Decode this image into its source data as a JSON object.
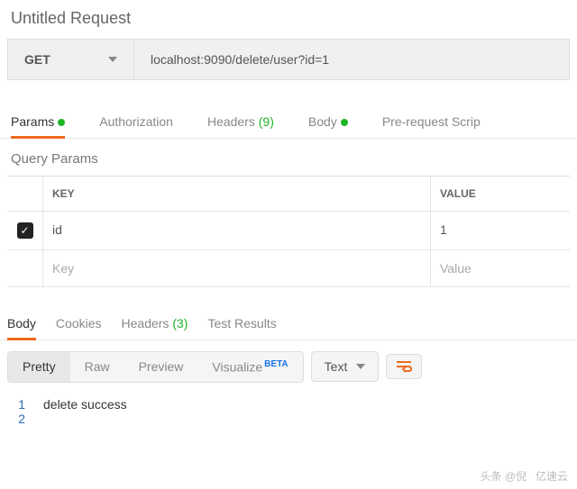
{
  "title": "Untitled Request",
  "request": {
    "method": "GET",
    "url": "localhost:9090/delete/user?id=1"
  },
  "tabs": {
    "params": "Params",
    "authorization": "Authorization",
    "headers": "Headers",
    "headers_count": "(9)",
    "body": "Body",
    "prerequest": "Pre-request Scrip"
  },
  "query": {
    "title": "Query Params",
    "head_key": "KEY",
    "head_value": "VALUE",
    "rows": [
      {
        "key": "id",
        "value": "1",
        "checked": true
      }
    ],
    "placeholder_key": "Key",
    "placeholder_value": "Value"
  },
  "response": {
    "tabs": {
      "body": "Body",
      "cookies": "Cookies",
      "headers": "Headers",
      "headers_count": "(3)",
      "tests": "Test Results"
    },
    "view": {
      "pretty": "Pretty",
      "raw": "Raw",
      "preview": "Preview",
      "visualize": "Visualize",
      "beta": "BETA"
    },
    "format": "Text",
    "lines": [
      "delete success",
      ""
    ]
  },
  "watermark": {
    "a": "头条 @倪",
    "b": "亿速云"
  }
}
